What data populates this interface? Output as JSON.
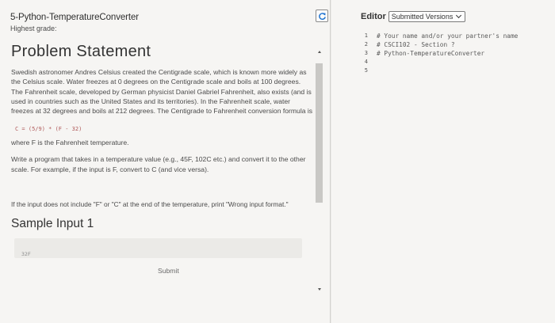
{
  "header": {
    "title": "5-Python-TemperatureConverter",
    "grade": "Highest grade:"
  },
  "problem": {
    "heading": "Problem Statement",
    "statement": "Swedish astronomer Andres Celsius created the Centigrade scale, which is known more widely as the Celsius scale. Water freezes at 0 degrees on the Centigrade scale and boils at 100 degrees. The Fahrenheit scale, developed by German physicist Daniel Gabriel Fahrenheit, also exists (and is used in countries such as the United States and its territories). In the Fahrenheit scale, water freezes at 32 degrees and boils at 212 degrees. The Centigrade to Fahrenheit conversion formula is",
    "formula": "C = (5/9) * (F - 32)",
    "where": "where F is the Fahrenheit temperature.",
    "write": "Write a program that takes in a temperature value (e.g., 45F, 102C etc.) and convert it to the other scale. For example, if the input is F, convert to C (and vice versa).",
    "error_note": "If the input does not include \"F\" or \"C\" at the end of the temperature, print \"Wrong input format.\"",
    "sample_heading": "Sample Input 1",
    "sample_value": "32F",
    "submit_label": "Submit"
  },
  "editor": {
    "label": "Editor",
    "version_select": "Submitted Versions",
    "lines": [
      {
        "num": "1",
        "text": "# Your name and/or your partner's name"
      },
      {
        "num": "2",
        "text": "# CSCI102 - Section ?"
      },
      {
        "num": "3",
        "text": "# Python-TemperatureConverter"
      },
      {
        "num": "4",
        "text": ""
      },
      {
        "num": "5",
        "text": ""
      }
    ]
  },
  "icons": {
    "refresh": "refresh-icon",
    "dropdown": "chevron-down-icon",
    "scroll_up": "arrow-up-icon",
    "scroll_down": "arrow-down-icon"
  },
  "colors": {
    "formula": "#b05a5a",
    "refresh_icon": "#1f73d1"
  }
}
